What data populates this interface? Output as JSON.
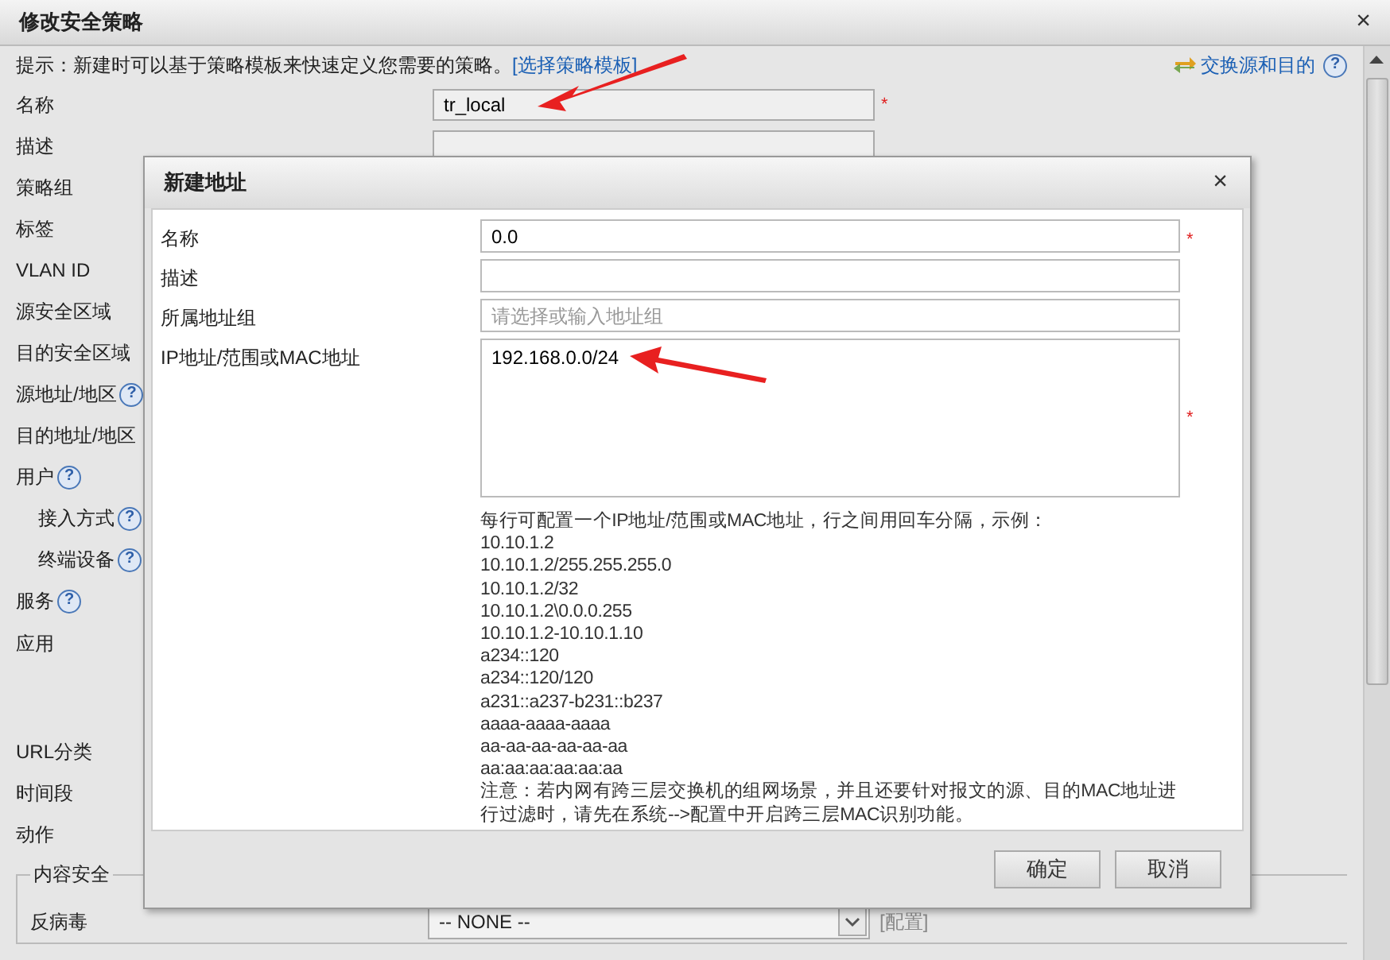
{
  "window": {
    "title": "修改安全策略",
    "close": "×"
  },
  "hint": {
    "text": "提示：新建时可以基于策略模板来快速定义您需要的策略。",
    "link": "[选择策略模板]"
  },
  "swap_link": {
    "label": "交换源和目的",
    "help": "?"
  },
  "form_rows": [
    {
      "label": "名称",
      "kind": "input",
      "value": "tr_local",
      "required_mark": "*"
    },
    {
      "label": "描述",
      "kind": "input"
    },
    {
      "label": "策略组",
      "kind": "plain"
    },
    {
      "label": "标签",
      "kind": "plain"
    },
    {
      "label": "VLAN ID",
      "kind": "plain"
    },
    {
      "label": "源安全区域",
      "kind": "plain"
    },
    {
      "label": "目的安全区域",
      "kind": "plain"
    },
    {
      "label": "源地址/地区",
      "kind": "plain",
      "help": "?"
    },
    {
      "label": "目的地址/地区",
      "kind": "plain"
    },
    {
      "label": "用户",
      "kind": "plain",
      "help": "?",
      "children": [
        {
          "label": "接入方式",
          "help": "?"
        },
        {
          "label": "终端设备",
          "help": "?"
        }
      ]
    },
    {
      "label": "服务",
      "kind": "plain",
      "help": "?"
    },
    {
      "label": "应用",
      "kind": "list"
    },
    {
      "label": "URL分类",
      "kind": "plain"
    },
    {
      "label": "时间段",
      "kind": "plain"
    },
    {
      "label": "动作",
      "kind": "plain"
    }
  ],
  "content_security": {
    "legend": "内容安全",
    "rows": [
      {
        "label": "反病毒",
        "select": "-- NONE --",
        "link": "[配置]"
      }
    ]
  },
  "dialog": {
    "title": "新建地址",
    "close": "×",
    "fields": [
      {
        "label": "名称",
        "kind": "input",
        "value": "0.0",
        "required_mark": "*"
      },
      {
        "label": "描述",
        "kind": "input"
      },
      {
        "label": "所属地址组",
        "kind": "input",
        "placeholder": "请选择或输入地址组"
      },
      {
        "label": "IP地址/范围或MAC地址",
        "kind": "textarea",
        "value": "192.168.0.0/24",
        "required_mark": "*"
      }
    ],
    "help_lines": [
      "每行可配置一个IP地址/范围或MAC地址，行之间用回车分隔，示例：",
      "10.10.1.2",
      "10.10.1.2/255.255.255.0",
      "10.10.1.2/32",
      "10.10.1.2\\0.0.0.255",
      "10.10.1.2-10.10.1.10",
      "a234::120",
      "a234::120/120",
      "a231::a237-b231::b237",
      "aaaa-aaaa-aaaa",
      "aa-aa-aa-aa-aa-aa",
      "aa:aa:aa:aa:aa:aa",
      "注意：若内网有跨三层交换机的组网场景，并且还要针对报文的源、目的MAC地址进行过滤时，请先在系统-->配置中开启跨三层MAC识别功能。"
    ],
    "buttons": [
      "确定",
      "取消"
    ]
  }
}
